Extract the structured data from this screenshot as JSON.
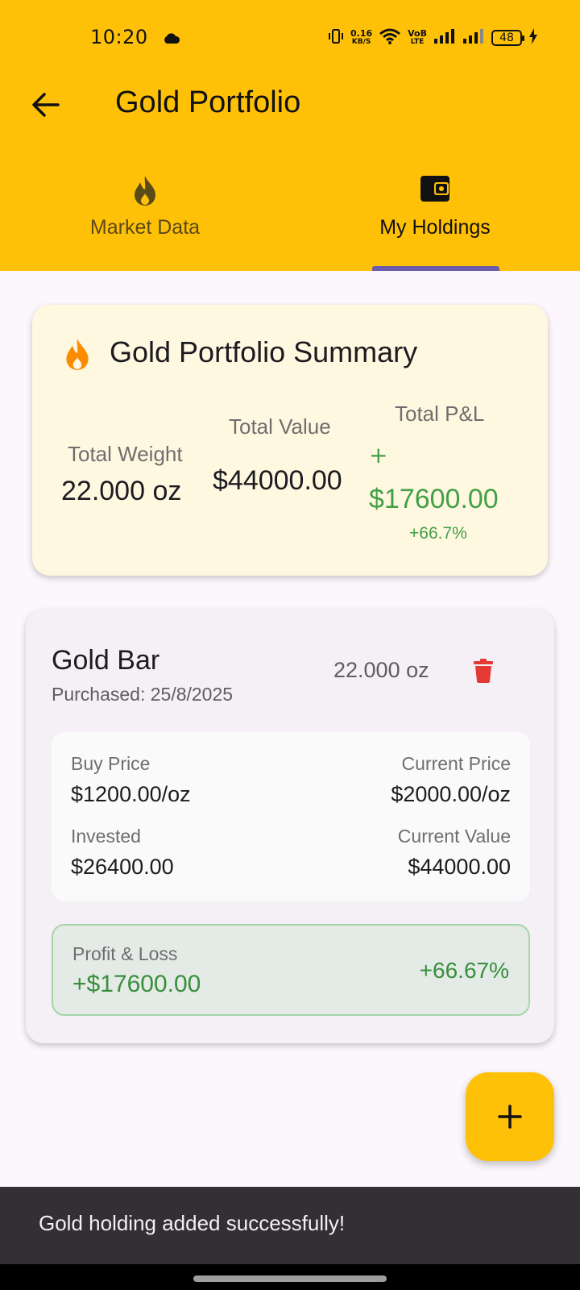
{
  "status_bar": {
    "time": "10:20",
    "net_speed_top": "0.16",
    "net_speed_bottom": "KB/S",
    "volte_top": "VoB",
    "volte_bottom": "LTE",
    "battery": "48"
  },
  "app_bar": {
    "title": "Gold Portfolio"
  },
  "tabs": [
    {
      "label": "Market Data",
      "icon": "flame-icon",
      "selected": false
    },
    {
      "label": "My Holdings",
      "icon": "wallet-icon",
      "selected": true
    }
  ],
  "summary": {
    "title": "Gold Portfolio Summary",
    "total_weight_label": "Total Weight",
    "total_weight_value": "22.000 oz",
    "total_value_label": "Total Value",
    "total_value_value": "$44000.00",
    "total_pl_label": "Total P&L",
    "total_pl_sign": "+",
    "total_pl_value": "$17600.00",
    "total_pl_percent": "+66.7%"
  },
  "holding": {
    "name": "Gold Bar",
    "purchased": "Purchased: 25/8/2025",
    "quantity": "22.000 oz",
    "buy_price_label": "Buy Price",
    "buy_price_value": "$1200.00/oz",
    "current_price_label": "Current Price",
    "current_price_value": "$2000.00/oz",
    "invested_label": "Invested",
    "invested_value": "$26400.00",
    "current_value_label": "Current Value",
    "current_value_value": "$44000.00",
    "pl_label": "Profit & Loss",
    "pl_value": "+$17600.00",
    "pl_percent": "+66.67%"
  },
  "snackbar": {
    "message": "Gold holding added successfully!"
  },
  "colors": {
    "primary": "#FFC107",
    "profit_green": "#43A047",
    "delete_red": "#E53935",
    "flame_orange": "#FB8C00"
  }
}
